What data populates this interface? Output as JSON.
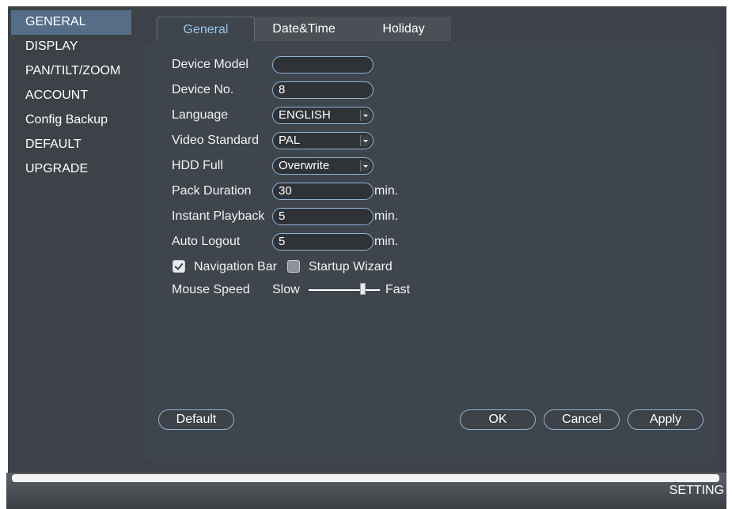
{
  "sidebar": {
    "items": [
      {
        "label": "GENERAL"
      },
      {
        "label": "DISPLAY"
      },
      {
        "label": "PAN/TILT/ZOOM"
      },
      {
        "label": "ACCOUNT"
      },
      {
        "label": "Config Backup"
      },
      {
        "label": "DEFAULT"
      },
      {
        "label": "UPGRADE"
      }
    ],
    "active": "GENERAL"
  },
  "tabs": [
    {
      "label": "General"
    },
    {
      "label": "Date&Time"
    },
    {
      "label": "Holiday"
    }
  ],
  "form": {
    "device_model": {
      "label": "Device Model",
      "value": ""
    },
    "device_no": {
      "label": "Device No.",
      "value": "8"
    },
    "language": {
      "label": "Language",
      "value": "ENGLISH"
    },
    "video_standard": {
      "label": "Video Standard",
      "value": "PAL"
    },
    "hdd_full": {
      "label": "HDD Full",
      "value": "Overwrite"
    },
    "pack_duration": {
      "label": "Pack Duration",
      "value": "30",
      "unit": "min."
    },
    "instant_playback": {
      "label": "Instant Playback",
      "value": "5",
      "unit": "min."
    },
    "auto_logout": {
      "label": "Auto Logout",
      "value": "5",
      "unit": "min."
    },
    "navigation_bar": {
      "label": "Navigation Bar",
      "checked": true
    },
    "startup_wizard": {
      "label": "Startup Wizard",
      "checked": false
    },
    "mouse_speed": {
      "label": "Mouse Speed",
      "slow": "Slow",
      "fast": "Fast",
      "level": 0.75
    }
  },
  "buttons": {
    "default": "Default",
    "ok": "OK",
    "cancel": "Cancel",
    "apply": "Apply"
  },
  "footer": {
    "label": "SETTING"
  },
  "colors": {
    "active_sidebar": "#566d88",
    "active_tab_text": "#9cc6ee",
    "field_border": "#8fb3d8"
  }
}
